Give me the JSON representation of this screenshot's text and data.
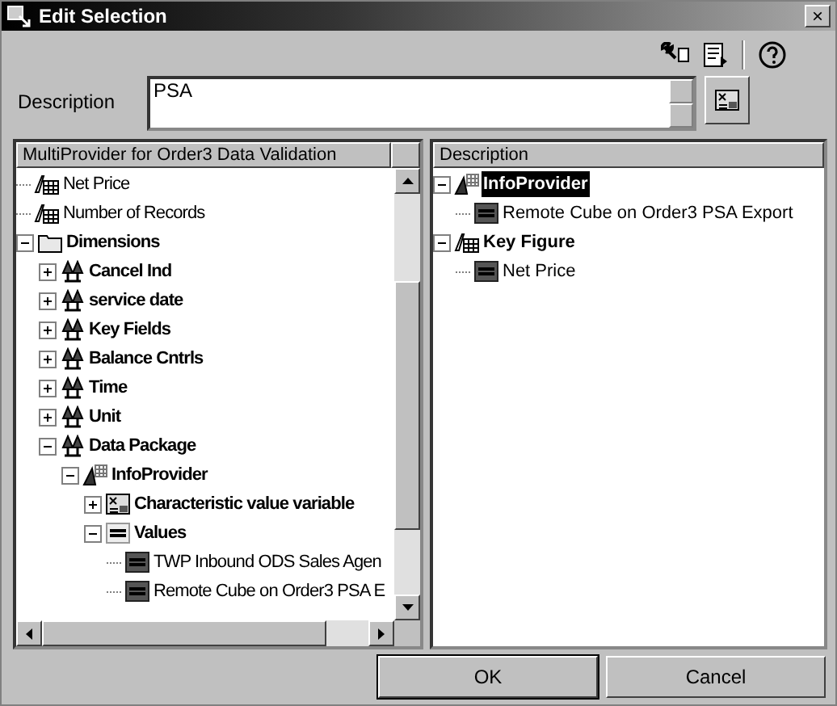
{
  "window": {
    "title": "Edit Selection",
    "close": "×"
  },
  "description": {
    "label": "Description",
    "value": "PSA"
  },
  "left_panel": {
    "header": "MultiProvider for Order3 Data Validation",
    "items": [
      {
        "kind": "keyfigure",
        "label": "Net Price",
        "bold": false
      },
      {
        "kind": "keyfigure",
        "label": "Number of Records",
        "bold": false
      },
      {
        "kind": "folder",
        "label": "Dimensions",
        "bold": true,
        "expanded": true,
        "children": [
          {
            "kind": "characteristic",
            "label": "Cancel Ind",
            "bold": true,
            "expanded": false
          },
          {
            "kind": "characteristic",
            "label": "service date",
            "bold": true,
            "expanded": false
          },
          {
            "kind": "characteristic",
            "label": "Key Fields",
            "bold": true,
            "expanded": false
          },
          {
            "kind": "characteristic",
            "label": "Balance Cntrls",
            "bold": true,
            "expanded": false
          },
          {
            "kind": "characteristic",
            "label": "Time",
            "bold": true,
            "expanded": false
          },
          {
            "kind": "characteristic",
            "label": "Unit",
            "bold": true,
            "expanded": false
          },
          {
            "kind": "characteristic",
            "label": "Data Package",
            "bold": true,
            "expanded": true,
            "children": [
              {
                "kind": "infoprovider",
                "label": "InfoProvider",
                "bold": true,
                "expanded": true,
                "children": [
                  {
                    "kind": "variable",
                    "label": "Characteristic value variable",
                    "bold": true,
                    "expanded": false
                  },
                  {
                    "kind": "values",
                    "label": "Values",
                    "bold": true,
                    "expanded": true,
                    "children": [
                      {
                        "kind": "value",
                        "label": "TWP Inbound ODS Sales Agen",
                        "bold": false
                      },
                      {
                        "kind": "value",
                        "label": "Remote Cube on Order3 PSA E",
                        "bold": false
                      }
                    ]
                  }
                ]
              }
            ]
          }
        ]
      }
    ]
  },
  "right_panel": {
    "header": "Description",
    "items": [
      {
        "kind": "infoprovider",
        "label": "InfoProvider",
        "bold": true,
        "expanded": true,
        "selected": true,
        "children": [
          {
            "kind": "value",
            "label": "Remote Cube on Order3 PSA Export",
            "bold": false,
            "selected": false
          }
        ]
      },
      {
        "kind": "keyfigure",
        "label": "Key Figure",
        "bold": true,
        "expanded": true,
        "selected": false,
        "children": [
          {
            "kind": "value",
            "label": "Net Price",
            "bold": false,
            "selected": false
          }
        ]
      }
    ]
  },
  "buttons": [
    {
      "label": "OK",
      "default": true
    },
    {
      "label": "Cancel",
      "default": false
    }
  ]
}
